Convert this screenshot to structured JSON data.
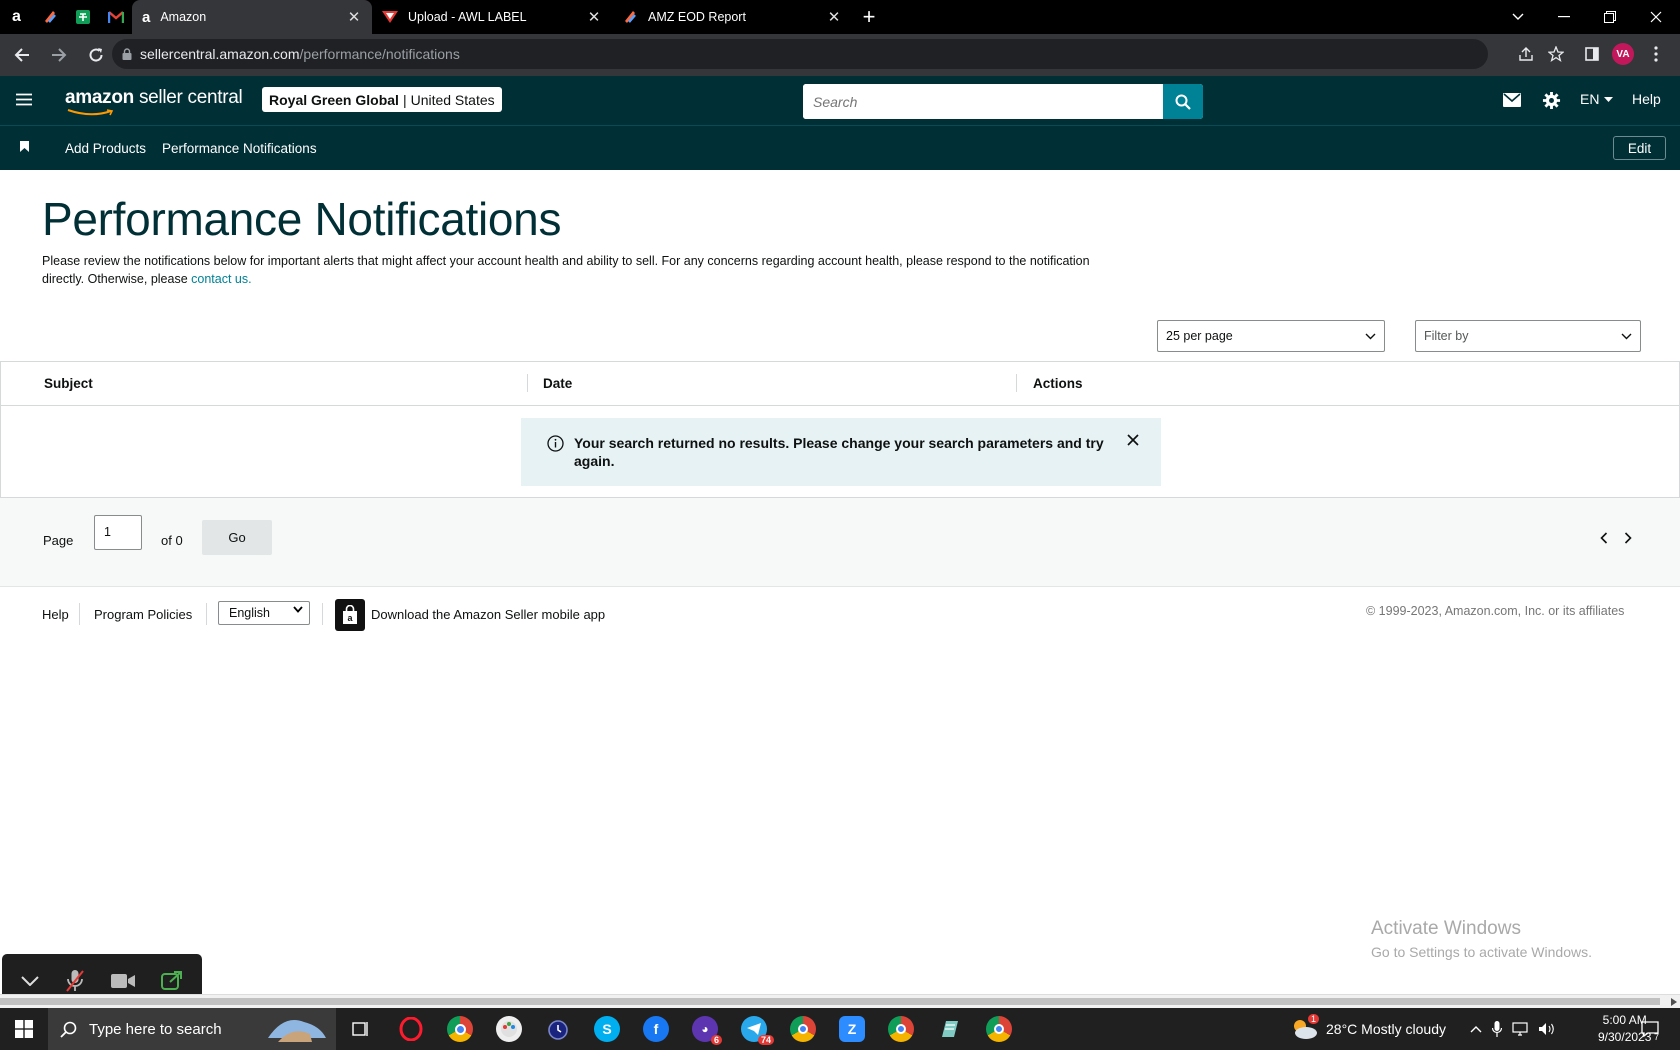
{
  "browser": {
    "tabs": [
      {
        "title": "Amazon",
        "icon": "amazon-icon",
        "active": true
      },
      {
        "title": "Upload - AWL LABEL",
        "icon": "awl-icon",
        "active": false
      },
      {
        "title": "AMZ EOD Report",
        "icon": "zapier-icon",
        "active": false
      }
    ],
    "url_host": "sellercentral.amazon.com",
    "url_path": "/performance/notifications",
    "profile_initials": "VA"
  },
  "header": {
    "logo_main": "amazon",
    "logo_sub": "seller central",
    "account_name": "Royal Green Global",
    "account_region": "United States",
    "search_placeholder": "Search",
    "language": "EN",
    "help": "Help"
  },
  "bookmarks": {
    "items": [
      "Add Products",
      "Performance Notifications"
    ],
    "edit": "Edit"
  },
  "page": {
    "title": "Performance Notifications",
    "desc_text": "Please review the notifications below for important alerts that might affect your account health and ability to sell. For any concerns regarding account health, please respond to the notification directly. Otherwise, please ",
    "desc_link": "contact us.",
    "per_page": "25 per page",
    "filter_placeholder": "Filter by"
  },
  "table": {
    "columns": [
      "Subject",
      "Date",
      "Actions"
    ],
    "empty_message": "Your search returned no results. Please change your search parameters and try again."
  },
  "pager": {
    "page_label": "Page",
    "page_value": "1",
    "of_label": "of 0",
    "go": "Go"
  },
  "footer": {
    "help": "Help",
    "policies": "Program Policies",
    "language": "English",
    "app_text": "Download the Amazon Seller mobile app",
    "copyright": "© 1999-2023, Amazon.com, Inc. or its affiliates"
  },
  "watermark": {
    "line1": "Activate Windows",
    "line2": "Go to Settings to activate Windows."
  },
  "taskbar": {
    "search_placeholder": "Type here to search",
    "weather": "28°C  Mostly cloudy",
    "time": "5:00 AM",
    "date": "9/30/2023",
    "badges": {
      "opera_gx": "6",
      "telegram": "74",
      "notifications": "7",
      "weather": "1"
    }
  }
}
